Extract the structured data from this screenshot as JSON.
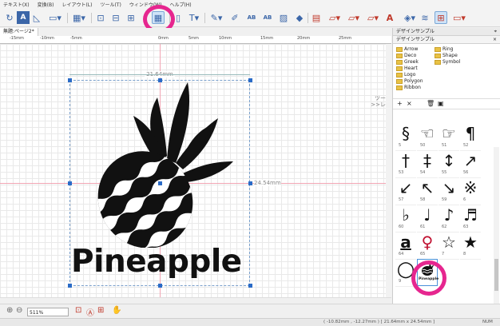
{
  "menubar": {
    "items": [
      "テキスト(X)",
      "変換(B)",
      "レイアウト(L)",
      "ツール(T)",
      "ウィンドウ(W)",
      "ヘルプ(H)"
    ]
  },
  "toolbar": {
    "icons": [
      "rotate-icon",
      "text-a-icon",
      "triangle-icon",
      "shape-icon",
      "grid-icon",
      "align-icon",
      "align2-icon",
      "align3-icon",
      "grid-layout-icon",
      "text-cursor-icon",
      "pen-icon",
      "brush-icon",
      "ab-icon",
      "ab2-icon",
      "image-icon",
      "fill-icon",
      "layout-icon",
      "frame-icon",
      "frame2-icon",
      "frame3-icon",
      "font-a-icon",
      "layers-icon",
      "stack-icon",
      "grid-toggle-icon",
      "panel-icon"
    ]
  },
  "document_tab": {
    "label": "無題:ページ2*"
  },
  "ruler": {
    "labels": [
      "-15mm",
      "-10mm",
      "-5mm",
      "0mm",
      "5mm",
      "10mm",
      "15mm",
      "20mm",
      "25mm"
    ]
  },
  "canvas": {
    "width_label": "21.64mm",
    "height_label": "24.54mm",
    "artwork_text": "Pineapple",
    "side_label_line1": "ツール",
    "side_label_line2": ">>レイヤ"
  },
  "status": {
    "zoom": "511%",
    "coords": "( -10.82mm , -12.27mm ) [ 21.64mm x 24.54mm ]",
    "mode": "NUM"
  },
  "design_sample_panel": {
    "title": "デザインサンプル",
    "subtitle": "デザインサンプル",
    "folders": [
      "Arrow",
      "Deco",
      "Greek",
      "Heart",
      "Logo",
      "Polygon",
      "Ribbon",
      "Ring",
      "Shape",
      "Symbol"
    ],
    "toolbar": [
      "+",
      "×",
      "trash",
      "save"
    ],
    "symbols": [
      {
        "glyph": "§",
        "label": "5"
      },
      {
        "glyph": "☜",
        "label": "50"
      },
      {
        "glyph": "☞",
        "label": "51"
      },
      {
        "glyph": "¶",
        "label": "52"
      },
      {
        "glyph": "†",
        "label": "53"
      },
      {
        "glyph": "‡",
        "label": "54"
      },
      {
        "glyph": "↕",
        "label": "55"
      },
      {
        "glyph": "↗",
        "label": "56"
      },
      {
        "glyph": "↙",
        "label": "57"
      },
      {
        "glyph": "↖",
        "label": "58"
      },
      {
        "glyph": "↘",
        "label": "59"
      },
      {
        "glyph": "※",
        "label": "6"
      },
      {
        "glyph": "♭",
        "label": "60"
      },
      {
        "glyph": "♩",
        "label": "61"
      },
      {
        "glyph": "♪",
        "label": "62"
      },
      {
        "glyph": "♬",
        "label": "63"
      },
      {
        "glyph": "a",
        "label": "64"
      },
      {
        "glyph": "♀",
        "label": "65"
      },
      {
        "glyph": "☆",
        "label": "7"
      },
      {
        "glyph": "★",
        "label": "8"
      },
      {
        "glyph": "○",
        "label": "9"
      },
      {
        "glyph": "Pineapple",
        "label": ""
      }
    ]
  },
  "colors": {
    "highlight": "#e6268f",
    "handle": "#2a6bc7",
    "guide": "#f2a6b4"
  }
}
